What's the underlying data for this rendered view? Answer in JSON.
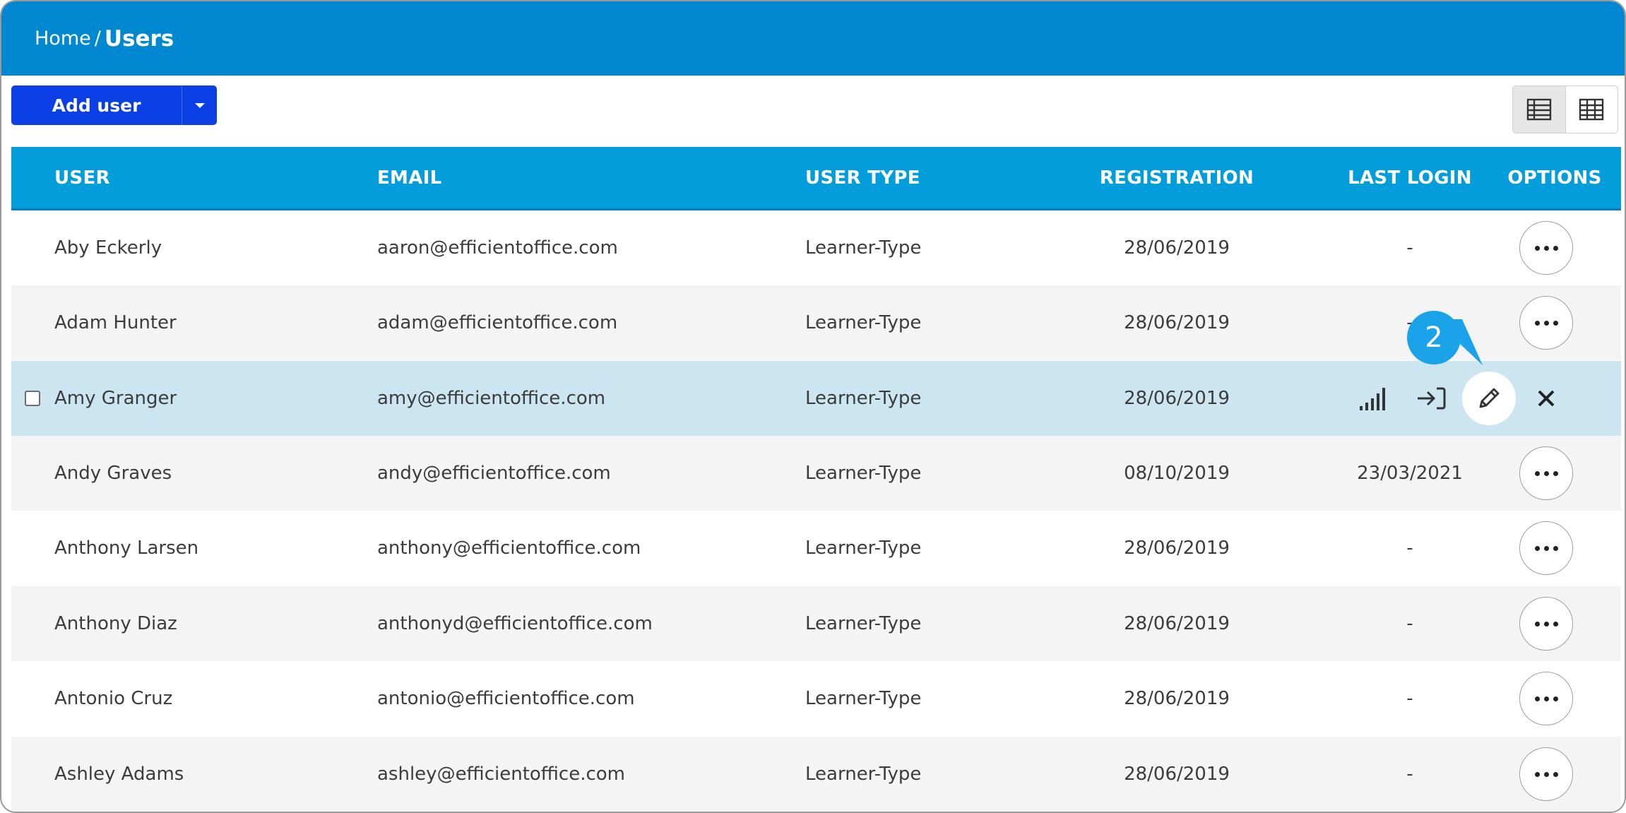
{
  "breadcrumb": {
    "home": "Home",
    "separator": "/",
    "current": "Users"
  },
  "toolbar": {
    "add_user_label": "Add user",
    "add_user_caret_icon": "caret-down-icon",
    "view_toggle": [
      {
        "icon": "list-view-icon",
        "active": true
      },
      {
        "icon": "grid-view-icon",
        "active": false
      }
    ]
  },
  "table": {
    "columns": [
      "USER",
      "EMAIL",
      "USER TYPE",
      "REGISTRATION",
      "LAST LOGIN",
      "OPTIONS"
    ],
    "rows": [
      {
        "user": "Aby Eckerly",
        "email": "aaron@efficientoffice.com",
        "type": "Learner-Type",
        "registration": "28/06/2019",
        "last_login": "-"
      },
      {
        "user": "Adam Hunter",
        "email": "adam@efficientoffice.com",
        "type": "Learner-Type",
        "registration": "28/06/2019",
        "last_login": "-"
      },
      {
        "user": "Amy Granger",
        "email": "amy@efficientoffice.com",
        "type": "Learner-Type",
        "registration": "28/06/2019",
        "last_login": ""
      },
      {
        "user": "Andy Graves",
        "email": "andy@efficientoffice.com",
        "type": "Learner-Type",
        "registration": "08/10/2019",
        "last_login": "23/03/2021"
      },
      {
        "user": "Anthony Larsen",
        "email": "anthony@efficientoffice.com",
        "type": "Learner-Type",
        "registration": "28/06/2019",
        "last_login": "-"
      },
      {
        "user": "Anthony Diaz",
        "email": "anthonyd@efficientoffice.com",
        "type": "Learner-Type",
        "registration": "28/06/2019",
        "last_login": "-"
      },
      {
        "user": "Antonio Cruz",
        "email": "antonio@efficientoffice.com",
        "type": "Learner-Type",
        "registration": "28/06/2019",
        "last_login": "-"
      },
      {
        "user": "Ashley Adams",
        "email": "ashley@efficientoffice.com",
        "type": "Learner-Type",
        "registration": "28/06/2019",
        "last_login": "-"
      }
    ],
    "hover_row_actions": [
      "signal-bars-icon",
      "login-arrow-icon",
      "pencil-icon",
      "close-icon"
    ]
  },
  "callout": {
    "label": "2"
  },
  "colors": {
    "header_bar": "#0288d1",
    "table_header": "#049ddc",
    "add_user_button": "#0b3fe6",
    "highlight_row": "#cce6f1",
    "callout": "#1aa3e8"
  }
}
